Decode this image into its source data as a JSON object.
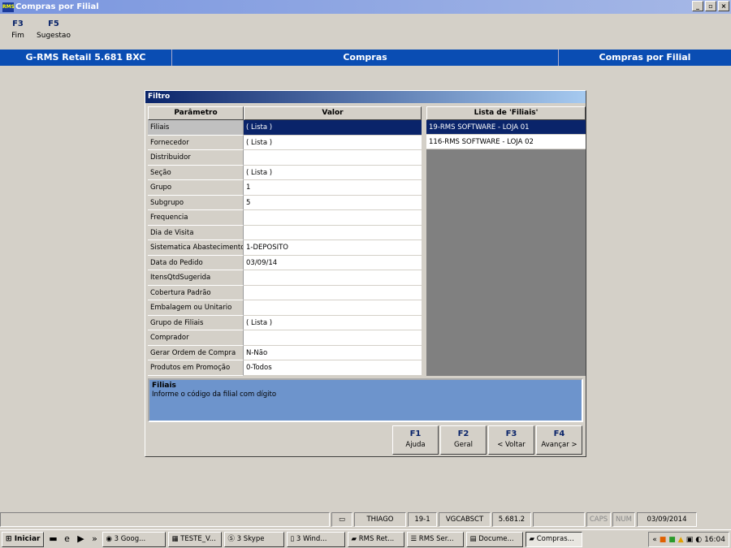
{
  "window": {
    "title": "Compras por Filial",
    "app_icon": "RMS"
  },
  "fkeys": [
    {
      "key": "F3",
      "label": "Fim"
    },
    {
      "key": "F5",
      "label": "Sugestao"
    }
  ],
  "infobar": {
    "product": "G-RMS Retail 5.681 BXC",
    "module": "Compras",
    "screen": "Compras por Filial"
  },
  "dialog": {
    "title": "Filtro",
    "col_param": "Parâmetro",
    "col_value": "Valor",
    "rows": [
      {
        "param": "Filiais",
        "value": "( Lista )"
      },
      {
        "param": "Fornecedor",
        "value": "( Lista )"
      },
      {
        "param": "Distribuidor",
        "value": ""
      },
      {
        "param": "Seção",
        "value": "( Lista )"
      },
      {
        "param": "Grupo",
        "value": "1"
      },
      {
        "param": "Subgrupo",
        "value": "5"
      },
      {
        "param": "Frequencia",
        "value": ""
      },
      {
        "param": "Dia de Visita",
        "value": ""
      },
      {
        "param": "Sistematica Abastecimento",
        "value": "1-DEPOSITO"
      },
      {
        "param": "Data do Pedido",
        "value": "03/09/14"
      },
      {
        "param": "ItensQtdSugerida",
        "value": ""
      },
      {
        "param": "Cobertura Padrão",
        "value": ""
      },
      {
        "param": "Embalagem ou Unitario",
        "value": ""
      },
      {
        "param": "Grupo de Filiais",
        "value": "( Lista )"
      },
      {
        "param": "Comprador",
        "value": ""
      },
      {
        "param": "Gerar Ordem de Compra",
        "value": "N-Não"
      },
      {
        "param": "Produtos em Promoção",
        "value": "0-Todos"
      }
    ],
    "list_title": "Lista de 'Filiais'",
    "list_items": [
      "19-RMS SOFTWARE - LOJA 01",
      "116-RMS SOFTWARE - LOJA 02"
    ],
    "help_title": "Filiais",
    "help_text": "Informe o código da filial com dígito",
    "buttons": [
      {
        "key": "F1",
        "label": "Ajuda"
      },
      {
        "key": "F2",
        "label": "Geral"
      },
      {
        "key": "F3",
        "label": "< Voltar"
      },
      {
        "key": "F4",
        "label": "Avançar >"
      }
    ]
  },
  "status": {
    "user": "THIAGO",
    "code": "19-1",
    "station": "VGCABSCT",
    "version": "5.681.2",
    "caps": "CAPS",
    "num": "NUM",
    "date": "03/09/2014"
  },
  "taskbar": {
    "start": "Iniciar",
    "items": [
      "3 Goog...",
      "TESTE_V...",
      "3 Skype",
      "3 Wind...",
      "RMS Ret...",
      "RMS Ser...",
      "Docume...",
      "Compras..."
    ],
    "clock": "16:04"
  }
}
